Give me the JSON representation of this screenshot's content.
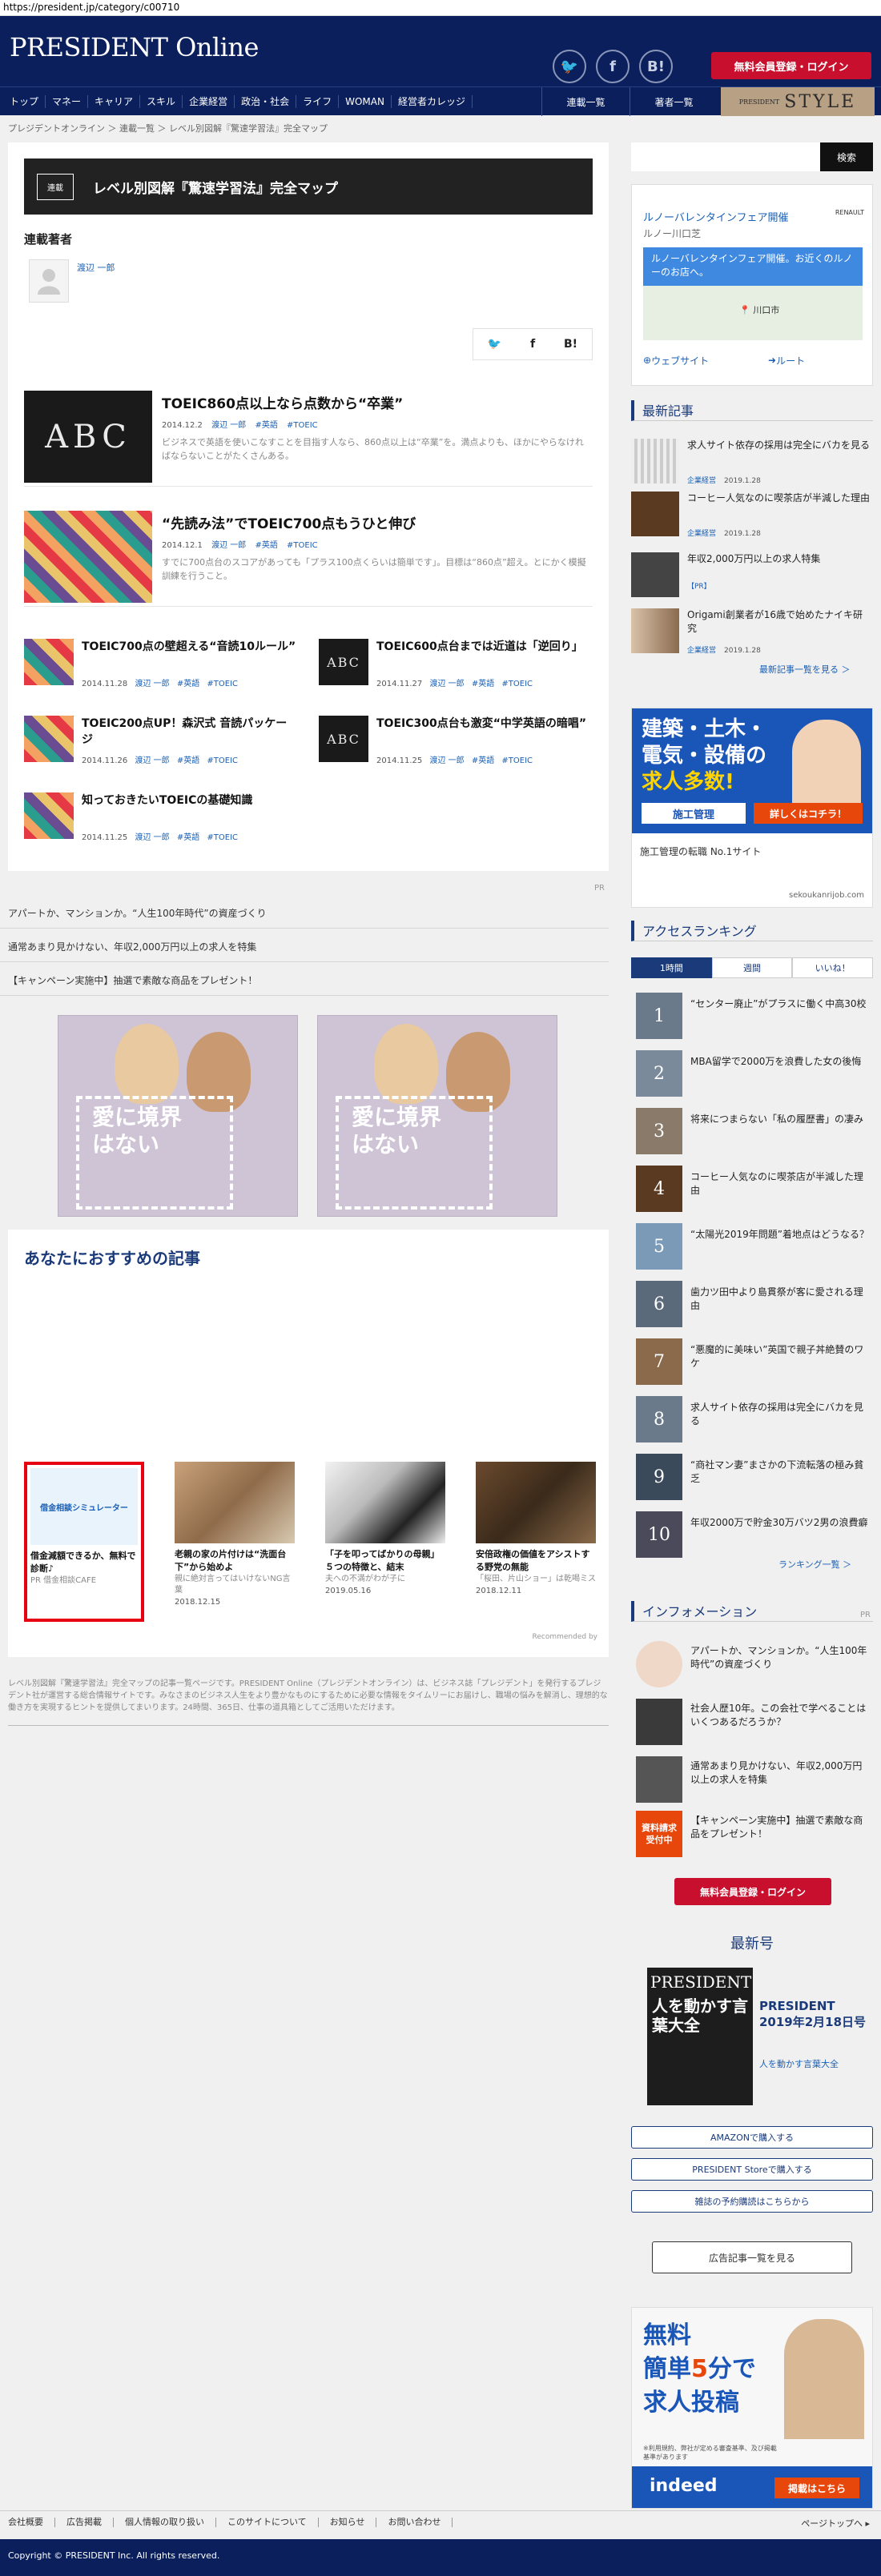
{
  "url": "https://president.jp/category/c00710",
  "header": {
    "logo": "PRESIDENT Online",
    "icons": [
      "twitter-icon",
      "facebook-icon",
      "hatena-icon"
    ],
    "icon_glyphs": [
      "🐦",
      "f",
      "B!"
    ],
    "register_label": "無料会員登録・ログイン",
    "nav": [
      "トップ",
      "マネー",
      "キャリア",
      "スキル",
      "企業経営",
      "政治・社会",
      "ライフ",
      "WOMAN",
      "経営者カレッジ"
    ],
    "nav_right": [
      "連載一覧",
      "著者一覧"
    ],
    "style_small": "PRESIDENT",
    "style_big": "STYLE"
  },
  "breadcrumb": "プレジデントオンライン ＞ 連載一覧 ＞ レベル別図解『驚速学習法』完全マップ",
  "series": {
    "tag": "連載",
    "title": "レベル別図解『驚速学習法』完全マップ",
    "authors_heading": "連載著者",
    "author_name": "渡辺 一郎",
    "share": [
      "🐦",
      "f",
      "B!"
    ]
  },
  "articles_big": [
    {
      "title": "TOEIC860点以上なら点数から“卒業”",
      "date": "2014.12.2",
      "author": "渡辺 一郎",
      "tags": [
        "#英語",
        "#TOEIC"
      ],
      "desc": "ビジネスで英語を使いこなすことを目指す人なら、860点以上は“卒業”を。満点よりも、ほかにやらなければならないことがたくさんある。"
    },
    {
      "title": "“先読み法”でTOEIC700点もうひと伸び",
      "date": "2014.12.1",
      "author": "渡辺 一郎",
      "tags": [
        "#英語",
        "#TOEIC"
      ],
      "desc": "すでに700点台のスコアがあっても「プラス100点くらいは簡単です」。目標は“860点”超え。とにかく模擬訓練を行うこと。"
    }
  ],
  "articles_small": [
    {
      "title": "TOEIC700点の壁超える“音読10ルール”",
      "date": "2014.11.28",
      "author": "渡辺 一郎",
      "tags": [
        "#英語",
        "#TOEIC"
      ]
    },
    {
      "title": "TOEIC600点台までは近道は「逆回り」",
      "date": "2014.11.27",
      "author": "渡辺 一郎",
      "tags": [
        "#英語",
        "#TOEIC"
      ]
    },
    {
      "title": "TOEIC200点UP！森沢式 音読パッケージ",
      "date": "2014.11.26",
      "author": "渡辺 一郎",
      "tags": [
        "#英語",
        "#TOEIC"
      ]
    },
    {
      "title": "TOEIC300点台も激変“中学英語の暗唱”",
      "date": "2014.11.25",
      "author": "渡辺 一郎",
      "tags": [
        "#英語",
        "#TOEIC"
      ]
    },
    {
      "title": "知っておきたいTOEICの基礎知識",
      "date": "2014.11.25",
      "author": "渡辺 一郎",
      "tags": [
        "#英語",
        "#TOEIC"
      ]
    }
  ],
  "pr_label": "PR",
  "pr_links": [
    "アパートか、マンションか。“人生100年時代”の資産づくり",
    "通常あまり見かけない、年収2,000万円以上の求人を特集",
    "【キャンペーン実施中】抽選で素敵な商品をプレゼント！"
  ],
  "ad_banner_text": "愛に境界はない",
  "recommend": {
    "heading": "あなたにおすすめの記事",
    "cards": [
      {
        "title": "借金減額できるか、無料で診断♪",
        "source": "PR 借金相談CAFE",
        "date": "",
        "img_text": "借金相談シミュレーター"
      },
      {
        "title": "老親の家の片付けは“洗面台下”から始めよ",
        "source": "親に絶対言ってはいけないNG言葉",
        "date": "2018.12.15",
        "img_text": ""
      },
      {
        "title": "「子を叩ってばかりの母親」５つの特徴と、結末",
        "source": "夫への不満がわが子に",
        "date": "2019.05.16",
        "img_text": ""
      },
      {
        "title": "安倍政権の価値をアシストする野党の無能",
        "source": "「桜田、片山ショー」は乾喝ミス",
        "date": "2018.12.11",
        "img_text": ""
      }
    ],
    "powered": "Recommended by"
  },
  "footnote": "レベル別図解『驚速学習法』完全マップの記事一覧ページです。PRESIDENT Online（プレジデントオンライン）は、ビジネス誌「プレジデント」を発行するプレジデント社が運営する総合情報サイトです。みなさまのビジネス人生をより豊かなものにするために必要な情報をタイムリーにお届けし、職場の悩みを解消し、理想的な働き方を実現するヒントを提供してまいります。24時間、365日、仕事の道具箱としてご活用いただけます。",
  "sidebar": {
    "search_placeholder": "",
    "search_label": "検索",
    "map_ad": {
      "title": "ルノーバレンタインフェア開催",
      "location": "ルノー川口芝",
      "bubble": "ルノーバレンタインフェア開催。お近くのルノーのお店へ。",
      "place": "川口市",
      "btn_web": "ウェブサイト",
      "btn_route": "ルート",
      "brand": "RENAULT"
    },
    "latest_heading": "最新記事",
    "latest": [
      {
        "title": "求人サイト依存の採用は完全にバカを見る",
        "author": "企業経営",
        "date": "2019.1.28"
      },
      {
        "title": "コーヒー人気なのに喫茶店が半減した理由",
        "author": "企業経営",
        "date": "2019.1.28"
      },
      {
        "title": "年収2,000万円以上の求人特集",
        "author": "【PR】",
        "date": ""
      },
      {
        "title": "Origami創業者が16歳で始めたナイキ研究",
        "author": "企業経営",
        "date": "2019.1.28"
      }
    ],
    "latest_more": "最新記事一覧を見る ＞",
    "ad2": {
      "label": "広告",
      "line1": "建築・土木・",
      "line2": "電気・設備の",
      "line3": "求人多数!",
      "brand": "施工管理",
      "cta": "詳しくはコチラ！",
      "sub": "施工管理の転職 No.1サイト",
      "domain": "sekoukanrijob.com"
    },
    "rank_heading": "アクセスランキング",
    "rank_tabs": [
      "1時間",
      "週間",
      "いいね！"
    ],
    "ranking": [
      "“センター廃止”がプラスに働く中高30校",
      "MBA留学で2000万を浪費した女の後悔",
      "将来につまらない「私の履歴書」の凄み",
      "コーヒー人気なのに喫茶店が半減した理由",
      "“太陽光2019年問題”着地点はどうなる？",
      "歯力ツ田中より島貫祭が客に愛される理由",
      "“悪魔的に美味い”英国で親子丼絶賛のワケ",
      "求人サイト依存の採用は完全にバカを見る",
      "“商社マン妻”まさかの下流転落の極み貧乏",
      "年収2000万で貯金30万バツ2男の浪費癖"
    ],
    "rank_numbers": [
      "1",
      "2",
      "3",
      "4",
      "5",
      "6",
      "7",
      "8",
      "9",
      "10"
    ],
    "rank_more": "ランキング一覧 ＞",
    "info_heading": "インフォメーション",
    "info_pr": "PR",
    "info": [
      "アパートか、マンションか。“人生100年時代”の資産づくり",
      "社会人歴10年。この会社で学べることはいくつあるだろうか？",
      "通常あまり見かけない、年収2,000万円以上の求人を特集",
      "【キャンペーン実施中】抽選で素敵な商品をプレゼント！"
    ],
    "info_badge": "資料請求受付中",
    "register_label": "無料会員登録・ログイン",
    "issue_heading": "最新号",
    "issue_name": "PRESIDENT 2019年2月18日号",
    "issue_sub": "人を動かす言葉大全",
    "issue_cover_logo": "PRESIDENT",
    "issue_cover_title": "人を動かす言葉大全",
    "buy_buttons": [
      "AMAZONで購入する",
      "PRESIDENT Storeで購入する",
      "雑誌の予約購読はこちらから"
    ],
    "ad_list": "広告記事一覧を見る",
    "job_ad": {
      "line1": "無料",
      "line2a": "簡単",
      "line2b": "5",
      "line2c": "分で",
      "line3": "求人投稿",
      "fine": "※利用規約、弊社が定める審査基準、及び掲載基準があります",
      "brand": "indeed",
      "cta": "掲載はこちら"
    }
  },
  "footer": {
    "links": [
      "会社概要",
      "広告掲載",
      "個人情報の取り扱い",
      "このサイトについて",
      "お知らせ",
      "お問い合わせ"
    ],
    "pagetop": "ページトップへ ▸",
    "copyright": "Copyright © PRESIDENT Inc. All rights reserved."
  }
}
